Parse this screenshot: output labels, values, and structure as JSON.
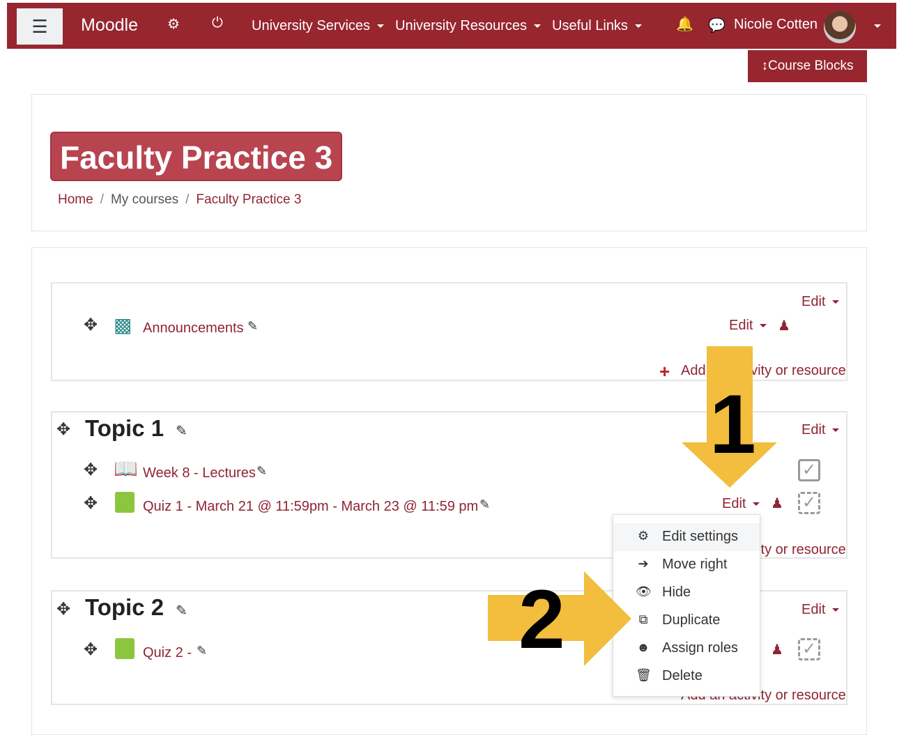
{
  "navbar": {
    "brand": "Moodle",
    "menu": [
      "University Services",
      "University Resources",
      "Useful Links"
    ],
    "user": "Nicole Cotten",
    "color": "#97262f"
  },
  "course_blocks": "Course Blocks",
  "page": {
    "title": "Faculty Practice 3",
    "breadcrumb": [
      "Home",
      "My courses",
      "Faculty Practice 3"
    ]
  },
  "sections": [
    {
      "edit": "Edit",
      "activities": [
        {
          "name": "Announcements",
          "edit": "Edit",
          "icon": "forum-icon"
        }
      ],
      "add": "Add an activity or resource"
    },
    {
      "title": "Topic 1",
      "edit": "Edit",
      "activities": [
        {
          "name": "Week 8 - Lectures",
          "icon": "book-icon"
        },
        {
          "name": "Quiz 1 - March 21 @ 11:59pm - March 23 @ 11:59 pm",
          "edit": "Edit",
          "icon": "quiz-icon"
        }
      ],
      "add": "Add an activity or resource"
    },
    {
      "title": "Topic 2",
      "edit": "Edit",
      "activities": [
        {
          "name": "Quiz 2 -",
          "icon": "quiz-icon"
        }
      ],
      "add": "Add an activity or resource"
    }
  ],
  "dropdown": [
    "Edit settings",
    "Move right",
    "Hide",
    "Duplicate",
    "Assign roles",
    "Delete"
  ],
  "annotations": {
    "step1": "1",
    "step2": "2",
    "arrow_color": "#f3bd3d"
  }
}
